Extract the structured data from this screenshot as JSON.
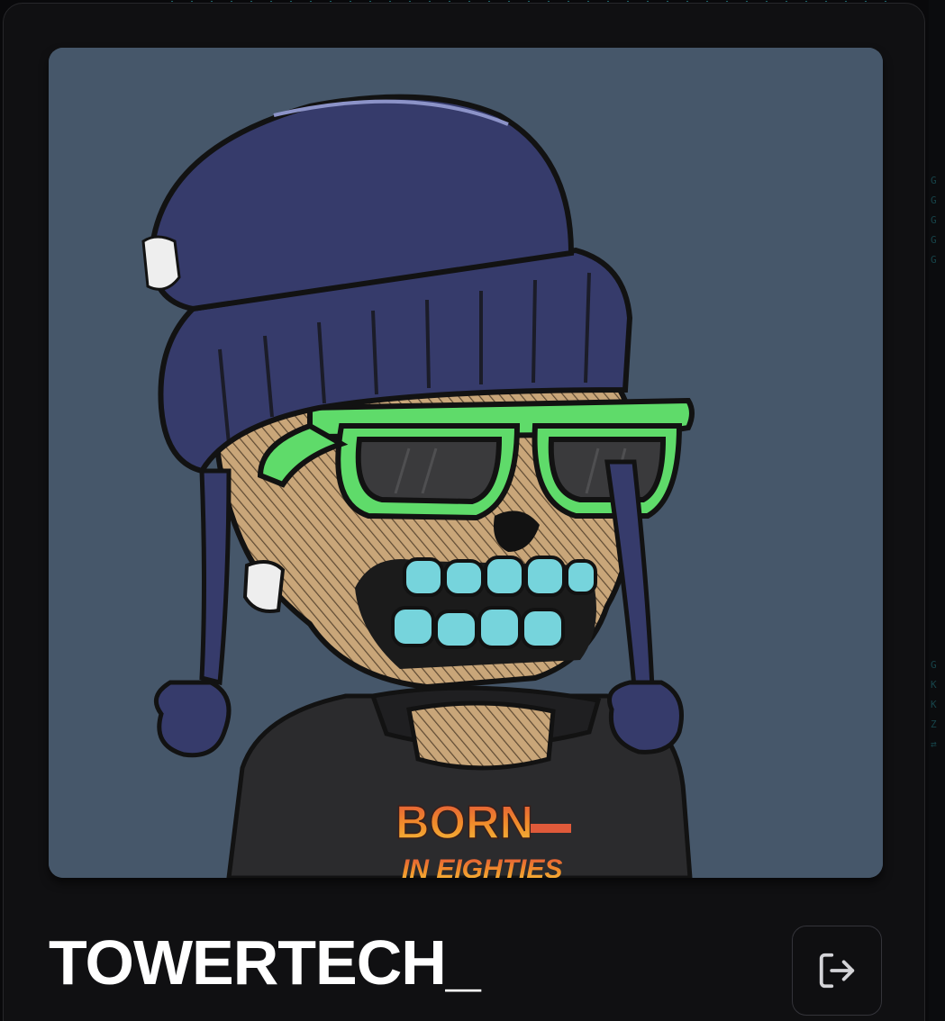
{
  "profile": {
    "username": "TOWERTECH_",
    "avatar": {
      "description_icon": "avatar-image",
      "shirt_text_line1": "BORN",
      "shirt_text_line2": "IN EIGHTIES"
    },
    "logout_icon": "logout-icon"
  },
  "background": {
    "code_chars": [
      "G",
      "G",
      "G",
      "G",
      "G",
      "",
      "",
      "",
      "",
      "",
      "",
      "",
      "",
      "",
      "",
      "",
      "",
      "",
      "",
      "",
      "",
      "",
      "",
      "",
      "G",
      "K",
      "K",
      "Z",
      "⇄"
    ]
  },
  "colors": {
    "page_bg": "#09090b",
    "card_bg": "#101012",
    "card_border": "#27272a",
    "avatar_bg": "#46576a",
    "beanie": "#363b6b",
    "glasses": "#5fdb6a",
    "teeth": "#73d3dc",
    "skull": "#c8a57a",
    "shirt": "#2a2a2c",
    "text": "#ffffff"
  }
}
